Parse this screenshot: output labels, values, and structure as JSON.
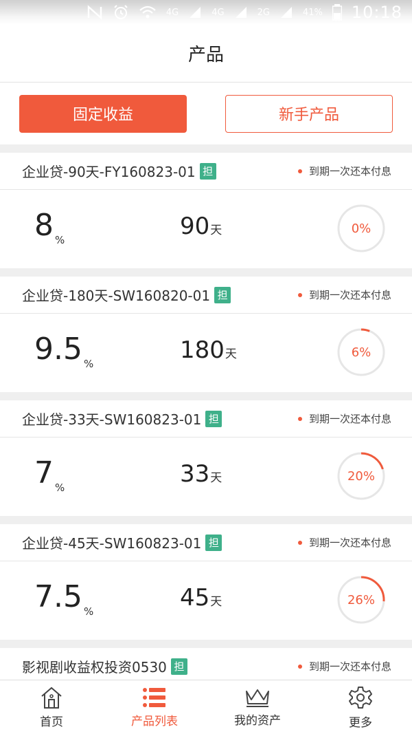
{
  "statusbar": {
    "icons": [
      "mute-icon",
      "alarm-icon",
      "wifi-icon",
      "4g-signal-icon",
      "4g-signal-icon",
      "2g-signal-icon"
    ],
    "net1": "4G",
    "net2": "4G",
    "net3": "2G",
    "battery": "41%",
    "time": "10:18"
  },
  "header": {
    "title": "产品"
  },
  "segments": [
    {
      "label": "固定收益",
      "active": true
    },
    {
      "label": "新手产品",
      "active": false
    }
  ],
  "products": [
    {
      "name": "企业贷-90天-FY160823-01",
      "tag": "担",
      "repay": "到期一次还本付息",
      "rate": "8",
      "rate_unit": "%",
      "term": "90",
      "term_unit": "天",
      "progress_pct": 0,
      "progress_label": "0%"
    },
    {
      "name": "企业贷-180天-SW160820-01",
      "tag": "担",
      "repay": "到期一次还本付息",
      "rate": "9.5",
      "rate_unit": "%",
      "term": "180",
      "term_unit": "天",
      "progress_pct": 6,
      "progress_label": "6%"
    },
    {
      "name": "企业贷-33天-SW160823-01",
      "tag": "担",
      "repay": "到期一次还本付息",
      "rate": "7",
      "rate_unit": "%",
      "term": "33",
      "term_unit": "天",
      "progress_pct": 20,
      "progress_label": "20%"
    },
    {
      "name": "企业贷-45天-SW160823-01",
      "tag": "担",
      "repay": "到期一次还本付息",
      "rate": "7.5",
      "rate_unit": "%",
      "term": "45",
      "term_unit": "天",
      "progress_pct": 26,
      "progress_label": "26%"
    },
    {
      "name": "影视剧收益权投资0530",
      "tag": "担",
      "repay": "到期一次还本付息"
    }
  ],
  "tabs": [
    {
      "label": "首页",
      "icon": "home-icon",
      "active": false
    },
    {
      "label": "产品列表",
      "icon": "list-icon",
      "active": true
    },
    {
      "label": "我的资产",
      "icon": "crown-icon",
      "active": false
    },
    {
      "label": "更多",
      "icon": "gear-icon",
      "active": false
    }
  ],
  "colors": {
    "accent": "#f05a3c",
    "tag": "#3fb08a",
    "ring_track": "#e6e6e6"
  }
}
